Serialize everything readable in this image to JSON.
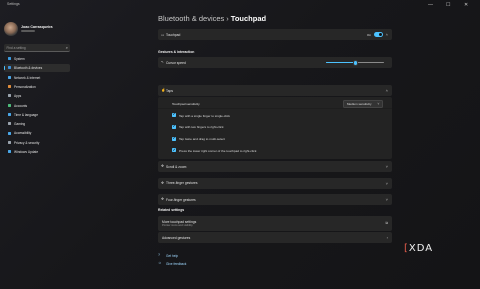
{
  "window": {
    "app_title": "Settings",
    "minimize": "—",
    "maximize": "☐",
    "close": "✕"
  },
  "user": {
    "name": "Joao Carrasqueira"
  },
  "search": {
    "placeholder": "Find a setting",
    "icon": "search-icon"
  },
  "sidebar": {
    "items": [
      {
        "label": "System",
        "icon": "display-icon",
        "color": "#3c9be0"
      },
      {
        "label": "Bluetooth & devices",
        "icon": "bluetooth-icon",
        "color": "#3c8fd6",
        "selected": true
      },
      {
        "label": "Network & internet",
        "icon": "wifi-icon",
        "color": "#4aa7e8"
      },
      {
        "label": "Personalization",
        "icon": "brush-icon",
        "color": "#e08d3c"
      },
      {
        "label": "Apps",
        "icon": "apps-icon",
        "color": "#9aa3ad"
      },
      {
        "label": "Accounts",
        "icon": "person-icon",
        "color": "#4dbb7a"
      },
      {
        "label": "Time & language",
        "icon": "globe-icon",
        "color": "#4aa7e8"
      },
      {
        "label": "Gaming",
        "icon": "controller-icon",
        "color": "#9aa3ad"
      },
      {
        "label": "Accessibility",
        "icon": "accessibility-icon",
        "color": "#4aa7e8"
      },
      {
        "label": "Privacy & security",
        "icon": "shield-icon",
        "color": "#9aa3ad"
      },
      {
        "label": "Windows Update",
        "icon": "update-icon",
        "color": "#4aa7e8"
      }
    ]
  },
  "breadcrumb": {
    "parent": "Bluetooth & devices",
    "separator": "›",
    "current": "Touchpad"
  },
  "touchpad": {
    "label": "Touchpad",
    "state": "On",
    "enabled": true
  },
  "gestures_section": {
    "title": "Gestures & interaction"
  },
  "cursor_speed": {
    "label": "Cursor speed",
    "value_fraction": 0.5
  },
  "taps": {
    "label": "Taps",
    "sensitivity_label": "Touchpad sensitivity",
    "sensitivity_value": "Medium sensitivity",
    "options": [
      {
        "label": "Tap with a single finger to single-click",
        "checked": true
      },
      {
        "label": "Tap with two fingers to right-click",
        "checked": true
      },
      {
        "label": "Tap twice and drag to multi-select",
        "checked": true
      },
      {
        "label": "Press the lower right corner of the touchpad to right-click",
        "checked": true
      }
    ]
  },
  "collapsed": [
    {
      "label": "Scroll & zoom"
    },
    {
      "label": "Three-finger gestures"
    },
    {
      "label": "Four-finger gestures"
    }
  ],
  "related_section": {
    "title": "Related settings"
  },
  "related": {
    "more_touchpad": {
      "title": "More touchpad settings",
      "subtitle": "Pointer icons and visibility"
    },
    "advanced_gestures": {
      "title": "Advanced gestures"
    }
  },
  "footer": {
    "get_help": "Get help",
    "give_feedback": "Give feedback"
  },
  "watermark": {
    "text": "XDA"
  },
  "colors": {
    "accent": "#4cc2ff",
    "card": "#272727",
    "background": "#161616"
  }
}
